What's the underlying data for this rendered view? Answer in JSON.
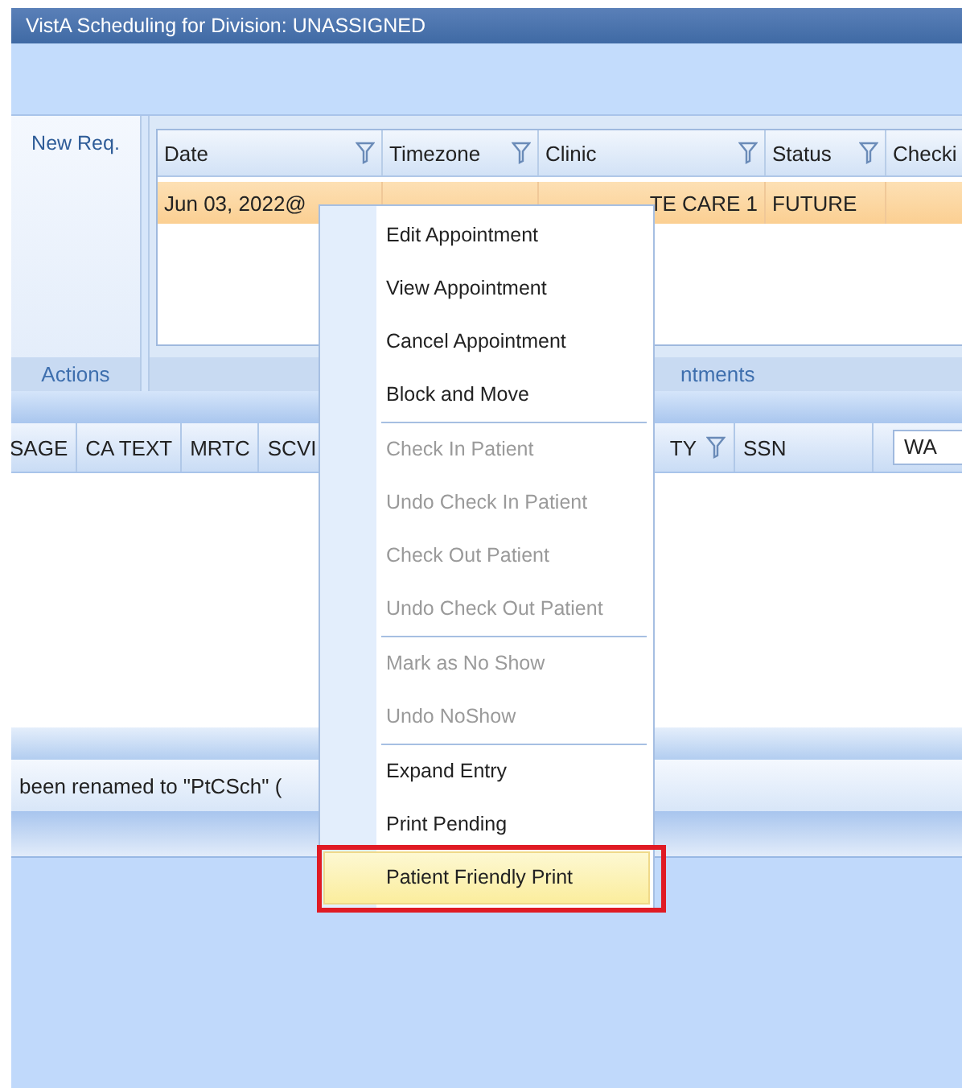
{
  "window": {
    "title": "VistA Scheduling for Division: UNASSIGNED"
  },
  "actions_panel": {
    "button": "New Req.",
    "group_label": "Actions"
  },
  "appointments": {
    "columns": [
      {
        "label": "Date",
        "filter": true
      },
      {
        "label": "Timezone",
        "filter": true
      },
      {
        "label": "Clinic",
        "filter": true
      },
      {
        "label": "Status",
        "filter": true
      },
      {
        "label": "Checki",
        "filter": false
      }
    ],
    "rows": [
      {
        "selected": true,
        "cells": [
          "Jun 03, 2022@",
          "",
          "TE CARE 1",
          "FUTURE",
          ""
        ]
      }
    ],
    "group_label": "ntments"
  },
  "patient_grid": {
    "columns_left": [
      "SAGE",
      "CA TEXT",
      "MRTC",
      "SCVI"
    ],
    "columns_right": [
      {
        "label": "TY",
        "filter": true
      },
      {
        "label": "SSN",
        "filter": false
      }
    ],
    "combo": "WA"
  },
  "status_bar": {
    "message": "been renamed to \"PtCSch\" ("
  },
  "context_menu": [
    {
      "kind": "item",
      "label": "Edit Appointment",
      "disabled": false,
      "selected": false,
      "outlined": false
    },
    {
      "kind": "item",
      "label": "View Appointment",
      "disabled": false,
      "selected": false,
      "outlined": false
    },
    {
      "kind": "item",
      "label": "Cancel Appointment",
      "disabled": false,
      "selected": false,
      "outlined": false
    },
    {
      "kind": "item",
      "label": "Block and Move",
      "disabled": false,
      "selected": false,
      "outlined": false
    },
    {
      "kind": "separator"
    },
    {
      "kind": "item",
      "label": "Check In Patient",
      "disabled": true,
      "selected": false,
      "outlined": false
    },
    {
      "kind": "item",
      "label": "Undo Check In Patient",
      "disabled": true,
      "selected": false,
      "outlined": false
    },
    {
      "kind": "item",
      "label": "Check Out Patient",
      "disabled": true,
      "selected": false,
      "outlined": false
    },
    {
      "kind": "item",
      "label": "Undo Check Out Patient",
      "disabled": true,
      "selected": false,
      "outlined": false
    },
    {
      "kind": "separator"
    },
    {
      "kind": "item",
      "label": "Mark as No Show",
      "disabled": true,
      "selected": false,
      "outlined": false
    },
    {
      "kind": "item",
      "label": "Undo NoShow",
      "disabled": true,
      "selected": false,
      "outlined": false
    },
    {
      "kind": "separator"
    },
    {
      "kind": "item",
      "label": "Expand Entry",
      "disabled": false,
      "selected": false,
      "outlined": false
    },
    {
      "kind": "item",
      "label": "Print Pending",
      "disabled": false,
      "selected": false,
      "outlined": false
    },
    {
      "kind": "item",
      "label": "Patient Friendly Print",
      "disabled": false,
      "selected": true,
      "outlined": true
    }
  ]
}
